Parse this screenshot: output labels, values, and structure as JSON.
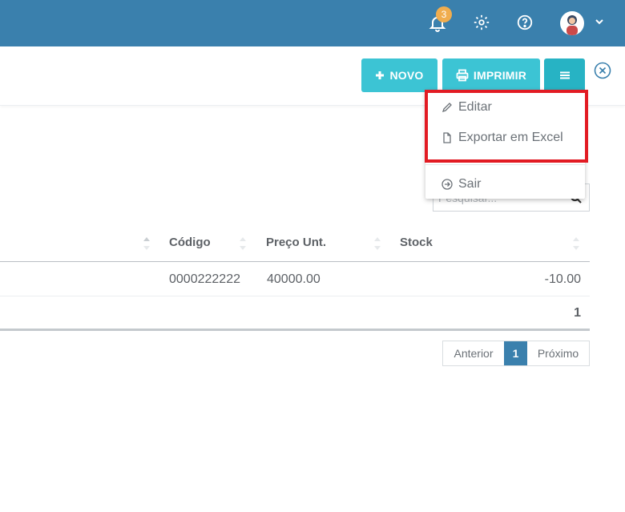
{
  "header": {
    "notification_count": "3",
    "icons": [
      "bell-icon",
      "gear-icon",
      "help-icon",
      "avatar",
      "chevron-down-icon"
    ],
    "color": "#3a80ad"
  },
  "toolbar": {
    "novo_label": "NOVO",
    "imprimir_label": "IMPRIMIR",
    "accent_color": "#3cc4d4"
  },
  "dropdown": {
    "items": [
      {
        "label": "Editar",
        "icon": "pencil-icon"
      },
      {
        "label": "Exportar em Excel",
        "icon": "file-icon"
      },
      {
        "label": "Sair",
        "icon": "arrow-circle-icon"
      }
    ],
    "highlight_color": "#e21b23"
  },
  "search": {
    "placeholder": "Pesquisar..."
  },
  "table": {
    "headers": [
      "Código",
      "Preço Unt.",
      "Stock"
    ],
    "rows": [
      {
        "codigo": "0000222222",
        "preco": "40000.00",
        "stock": "-10.00"
      }
    ],
    "footer_total": "1"
  },
  "pagination": {
    "prev_label": "Anterior",
    "current_page": "1",
    "next_label": "Próximo",
    "active_color": "#3a80ad"
  }
}
